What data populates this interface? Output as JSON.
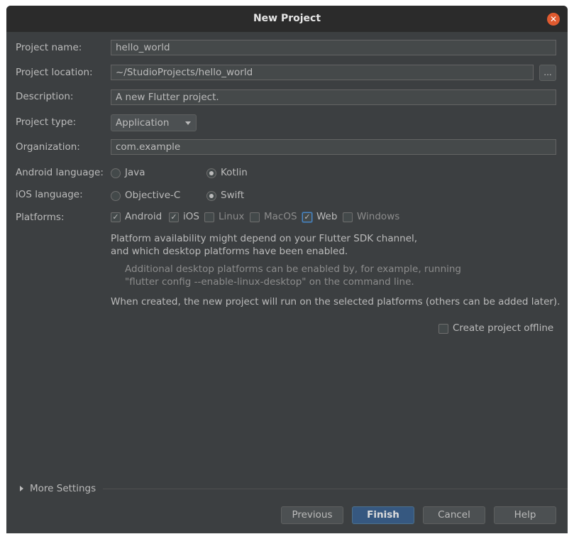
{
  "window": {
    "title": "New Project",
    "close_glyph": "✕"
  },
  "form": {
    "project_name": {
      "label": "Project name:",
      "value": "hello_world"
    },
    "project_location": {
      "label": "Project location:",
      "value": "~/StudioProjects/hello_world",
      "browse_label": "..."
    },
    "description": {
      "label": "Description:",
      "value": "A new Flutter project."
    },
    "project_type": {
      "label": "Project type:",
      "value": "Application"
    },
    "organization": {
      "label": "Organization:",
      "value": "com.example"
    },
    "android_language": {
      "label": "Android language:",
      "options": [
        {
          "label": "Java",
          "selected": false
        },
        {
          "label": "Kotlin",
          "selected": true
        }
      ]
    },
    "ios_language": {
      "label": "iOS language:",
      "options": [
        {
          "label": "Objective-C",
          "selected": false
        },
        {
          "label": "Swift",
          "selected": true
        }
      ]
    },
    "platforms": {
      "label": "Platforms:",
      "items": [
        {
          "label": "Android",
          "checked": true
        },
        {
          "label": "iOS",
          "checked": true
        },
        {
          "label": "Linux",
          "checked": false
        },
        {
          "label": "MacOS",
          "checked": false
        },
        {
          "label": "Web",
          "checked": true
        },
        {
          "label": "Windows",
          "checked": false
        }
      ]
    }
  },
  "info": {
    "availability_line1": "Platform availability might depend on your Flutter SDK channel,",
    "availability_line2": "and which desktop platforms have been enabled.",
    "hint_line1": "Additional desktop platforms can be enabled by, for example, running",
    "hint_line2": "\"flutter config --enable-linux-desktop\" on the command line.",
    "run_note": "When created, the new project will run on the selected platforms (others can be added later)."
  },
  "offline": {
    "label": "Create project offline",
    "checked": false
  },
  "more_settings": {
    "label": "More Settings"
  },
  "buttons": {
    "previous": "Previous",
    "finish": "Finish",
    "cancel": "Cancel",
    "help": "Help"
  },
  "check_glyph": "✓",
  "colors": {
    "background": "#3c3f41",
    "titlebar": "#2b2b2b",
    "close": "#e05a2f",
    "primary_button": "#365880"
  }
}
